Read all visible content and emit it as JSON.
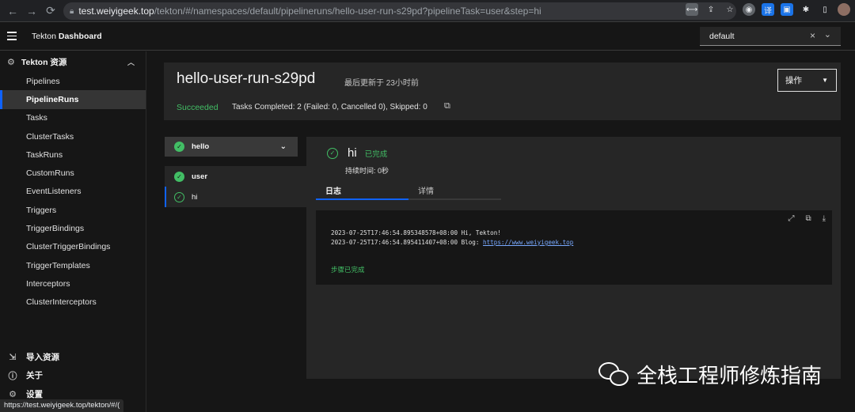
{
  "browser": {
    "url_host": "test.weiyigeek.top",
    "url_path": "/tekton/#/namespaces/default/pipelineruns/hello-user-run-s29pd?pipelineTask=user&step=hi",
    "status_url": "https://test.weiyigeek.top/tekton/#/("
  },
  "header": {
    "brand_prefix": "Tekton ",
    "brand_bold": "Dashboard",
    "namespace": "default",
    "clear_glyph": "×",
    "chevron_glyph": "⌄"
  },
  "sidebar": {
    "section_title": "Tekton 资源",
    "items": [
      {
        "label": "Pipelines"
      },
      {
        "label": "PipelineRuns"
      },
      {
        "label": "Tasks"
      },
      {
        "label": "ClusterTasks"
      },
      {
        "label": "TaskRuns"
      },
      {
        "label": "CustomRuns"
      },
      {
        "label": "EventListeners"
      },
      {
        "label": "Triggers"
      },
      {
        "label": "TriggerBindings"
      },
      {
        "label": "ClusterTriggerBindings"
      },
      {
        "label": "TriggerTemplates"
      },
      {
        "label": "Interceptors"
      },
      {
        "label": "ClusterInterceptors"
      }
    ],
    "active_index": 1,
    "bottom": {
      "import": "导入资源",
      "about": "关于",
      "settings": "设置"
    }
  },
  "run": {
    "name": "hello-user-run-s29pd",
    "updated": "最后更新于 23小时前",
    "actions_label": "操作",
    "status": "Succeeded",
    "tasks_summary": "Tasks Completed: 2 (Failed: 0, Cancelled 0), Skipped: 0"
  },
  "tree": {
    "task_name": "hello",
    "steps": [
      {
        "name": "user"
      },
      {
        "name": "hi"
      }
    ]
  },
  "step": {
    "name": "hi",
    "badge": "已完成",
    "duration": "持续时间: 0秒",
    "tabs": [
      {
        "label": "日志"
      },
      {
        "label": "详情"
      }
    ],
    "log": {
      "line1": "2023-07-25T17:46:54.895348578+08:00 Hi, Tekton!",
      "line2_prefix": "2023-07-25T17:46:54.895411407+08:00 Blog: ",
      "line2_link": "https://www.weiyigeek.top",
      "done": "步骤已完成"
    }
  },
  "watermark": {
    "text": "全栈工程师修炼指南"
  },
  "colors": {
    "accent": "#0f62fe",
    "success": "#42be65",
    "link": "#78a9ff"
  }
}
